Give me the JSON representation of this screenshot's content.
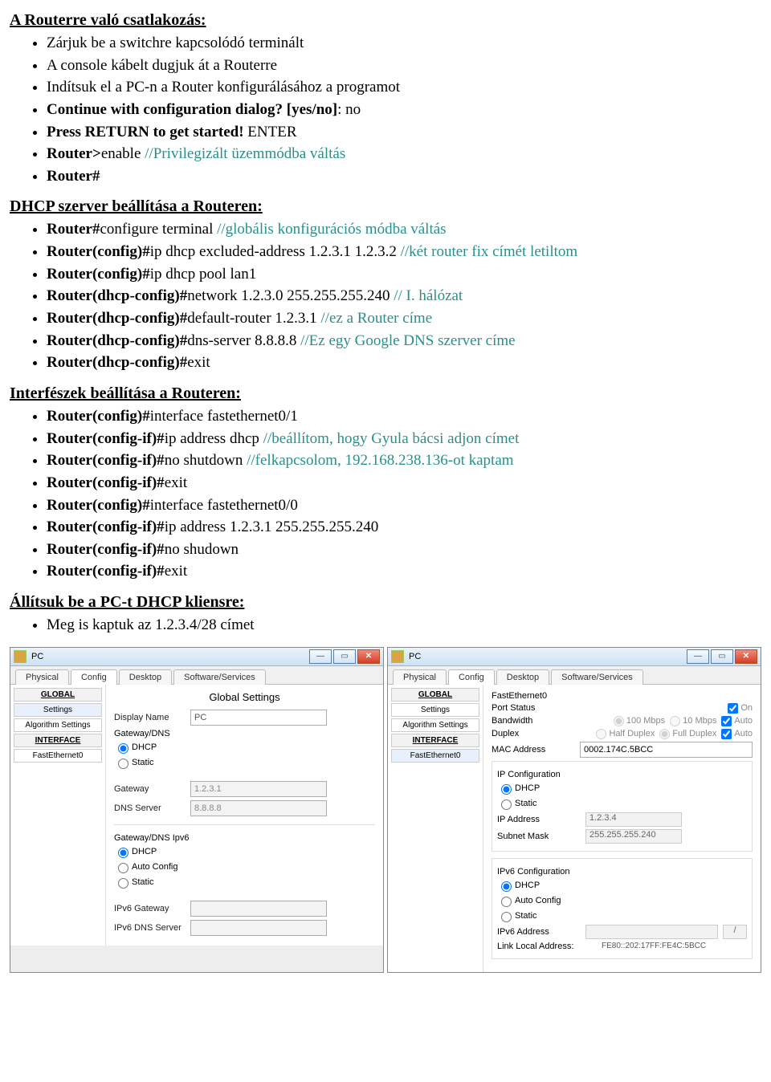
{
  "sections": {
    "s1": {
      "title": "A Routerre való csatlakozás:",
      "items": [
        {
          "t": "Zárjuk be a switchre kapcsolódó terminált"
        },
        {
          "t": "A console kábelt dugjuk át a Routerre"
        },
        {
          "t": "Indítsuk el a PC-n a Router konfigurálásához a programot"
        },
        {
          "parts": [
            {
              "b": "Continue with configuration dialog? [yes/no]"
            },
            {
              "p": ": no"
            }
          ]
        },
        {
          "parts": [
            {
              "b": "Press RETURN to get started!"
            },
            {
              "p": " ENTER"
            }
          ]
        },
        {
          "parts": [
            {
              "b": "Router>"
            },
            {
              "p": "enable "
            },
            {
              "c": "//Privilegizált üzemmódba váltás"
            }
          ]
        },
        {
          "parts": [
            {
              "b": "Router#"
            }
          ]
        }
      ]
    },
    "s2": {
      "title": "DHCP szerver beállítása a Routeren:",
      "items": [
        {
          "parts": [
            {
              "b": "Router#"
            },
            {
              "p": "configure terminal "
            },
            {
              "c": "//globális konfigurációs módba váltás"
            }
          ]
        },
        {
          "parts": [
            {
              "b": "Router(config)#"
            },
            {
              "p": "ip dhcp excluded-address 1.2.3.1 1.2.3.2 "
            },
            {
              "c": "//két router fix címét letiltom"
            }
          ]
        },
        {
          "parts": [
            {
              "b": "Router(config)#"
            },
            {
              "p": "ip dhcp pool lan1"
            }
          ]
        },
        {
          "parts": [
            {
              "b": "Router(dhcp-config)#"
            },
            {
              "p": "network 1.2.3.0 255.255.255.240 "
            },
            {
              "c": "// I. hálózat"
            }
          ]
        },
        {
          "parts": [
            {
              "b": "Router(dhcp-config)#"
            },
            {
              "p": "default-router 1.2.3.1 "
            },
            {
              "c": "//ez a Router címe"
            }
          ]
        },
        {
          "parts": [
            {
              "b": "Router(dhcp-config)#"
            },
            {
              "p": "dns-server 8.8.8.8 "
            },
            {
              "c": "//Ez egy Google DNS szerver címe"
            }
          ]
        },
        {
          "parts": [
            {
              "b": "Router(dhcp-config)#"
            },
            {
              "p": "exit"
            }
          ]
        }
      ]
    },
    "s3": {
      "title": "Interfészek beállítása a Routeren:",
      "items": [
        {
          "parts": [
            {
              "b": "Router(config)#"
            },
            {
              "p": "interface fastethernet0/1"
            }
          ]
        },
        {
          "parts": [
            {
              "b": "Router(config-if)#"
            },
            {
              "p": "ip address dhcp "
            },
            {
              "c": "//beállítom, hogy Gyula bácsi adjon címet"
            }
          ]
        },
        {
          "parts": [
            {
              "b": "Router(config-if)#"
            },
            {
              "p": "no shutdown "
            },
            {
              "c": "//felkapcsolom, 192.168.238.136-ot kaptam"
            }
          ]
        },
        {
          "parts": [
            {
              "b": "Router(config-if)#"
            },
            {
              "p": "exit"
            }
          ]
        },
        {
          "parts": [
            {
              "b": "Router(config)#"
            },
            {
              "p": "interface fastethernet0/0"
            }
          ]
        },
        {
          "parts": [
            {
              "b": "Router(config-if)#"
            },
            {
              "p": "ip address 1.2.3.1 255.255.255.240"
            }
          ]
        },
        {
          "parts": [
            {
              "b": "Router(config-if)#"
            },
            {
              "p": "no shudown"
            }
          ]
        },
        {
          "parts": [
            {
              "b": "Router(config-if)#"
            },
            {
              "p": "exit"
            }
          ]
        }
      ]
    },
    "s4": {
      "title": "Állítsuk be a PC-t DHCP kliensre:",
      "items": [
        {
          "t": "Meg is kaptuk az 1.2.3.4/28 címet"
        }
      ]
    }
  },
  "win": {
    "title": "PC",
    "tabs": [
      "Physical",
      "Config",
      "Desktop",
      "Software/Services"
    ],
    "active_tab": "Config",
    "sidebar": {
      "global": "GLOBAL",
      "settings": "Settings",
      "algo": "Algorithm Settings",
      "iface_h": "INTERFACE",
      "fe0": "FastEthernet0"
    }
  },
  "left_panel": {
    "title": "Global Settings",
    "display_name_label": "Display Name",
    "display_name": "PC",
    "gwdns": "Gateway/DNS",
    "dhcp": "DHCP",
    "static": "Static",
    "gateway_label": "Gateway",
    "gateway": "1.2.3.1",
    "dns_label": "DNS Server",
    "dns": "8.8.8.8",
    "gwdns6": "Gateway/DNS Ipv6",
    "auto": "Auto Config",
    "ipv6gw_label": "IPv6 Gateway",
    "ipv6gw": "",
    "ipv6dns_label": "IPv6 DNS Server",
    "ipv6dns": ""
  },
  "right_panel": {
    "title": "FastEthernet0",
    "port_status": "Port Status",
    "on": "On",
    "bandwidth": "Bandwidth",
    "bw_100": "100 Mbps",
    "bw_10": "10 Mbps",
    "auto": "Auto",
    "duplex": "Duplex",
    "half": "Half Duplex",
    "full": "Full Duplex",
    "mac": "MAC Address",
    "mac_v": "0002.174C.5BCC",
    "ipconf": "IP Configuration",
    "dhcp": "DHCP",
    "static": "Static",
    "ipaddr": "IP Address",
    "ipaddr_v": "1.2.3.4",
    "subnet": "Subnet Mask",
    "subnet_v": "255.255.255.240",
    "ipv6conf": "IPv6 Configuration",
    "autoconf": "Auto Config",
    "ipv6addr": "IPv6 Address",
    "ipv6addr_v": "",
    "ipv6_pl": "/",
    "lla_label": "Link Local Address:",
    "lla": "FE80::202:17FF:FE4C:5BCC"
  }
}
